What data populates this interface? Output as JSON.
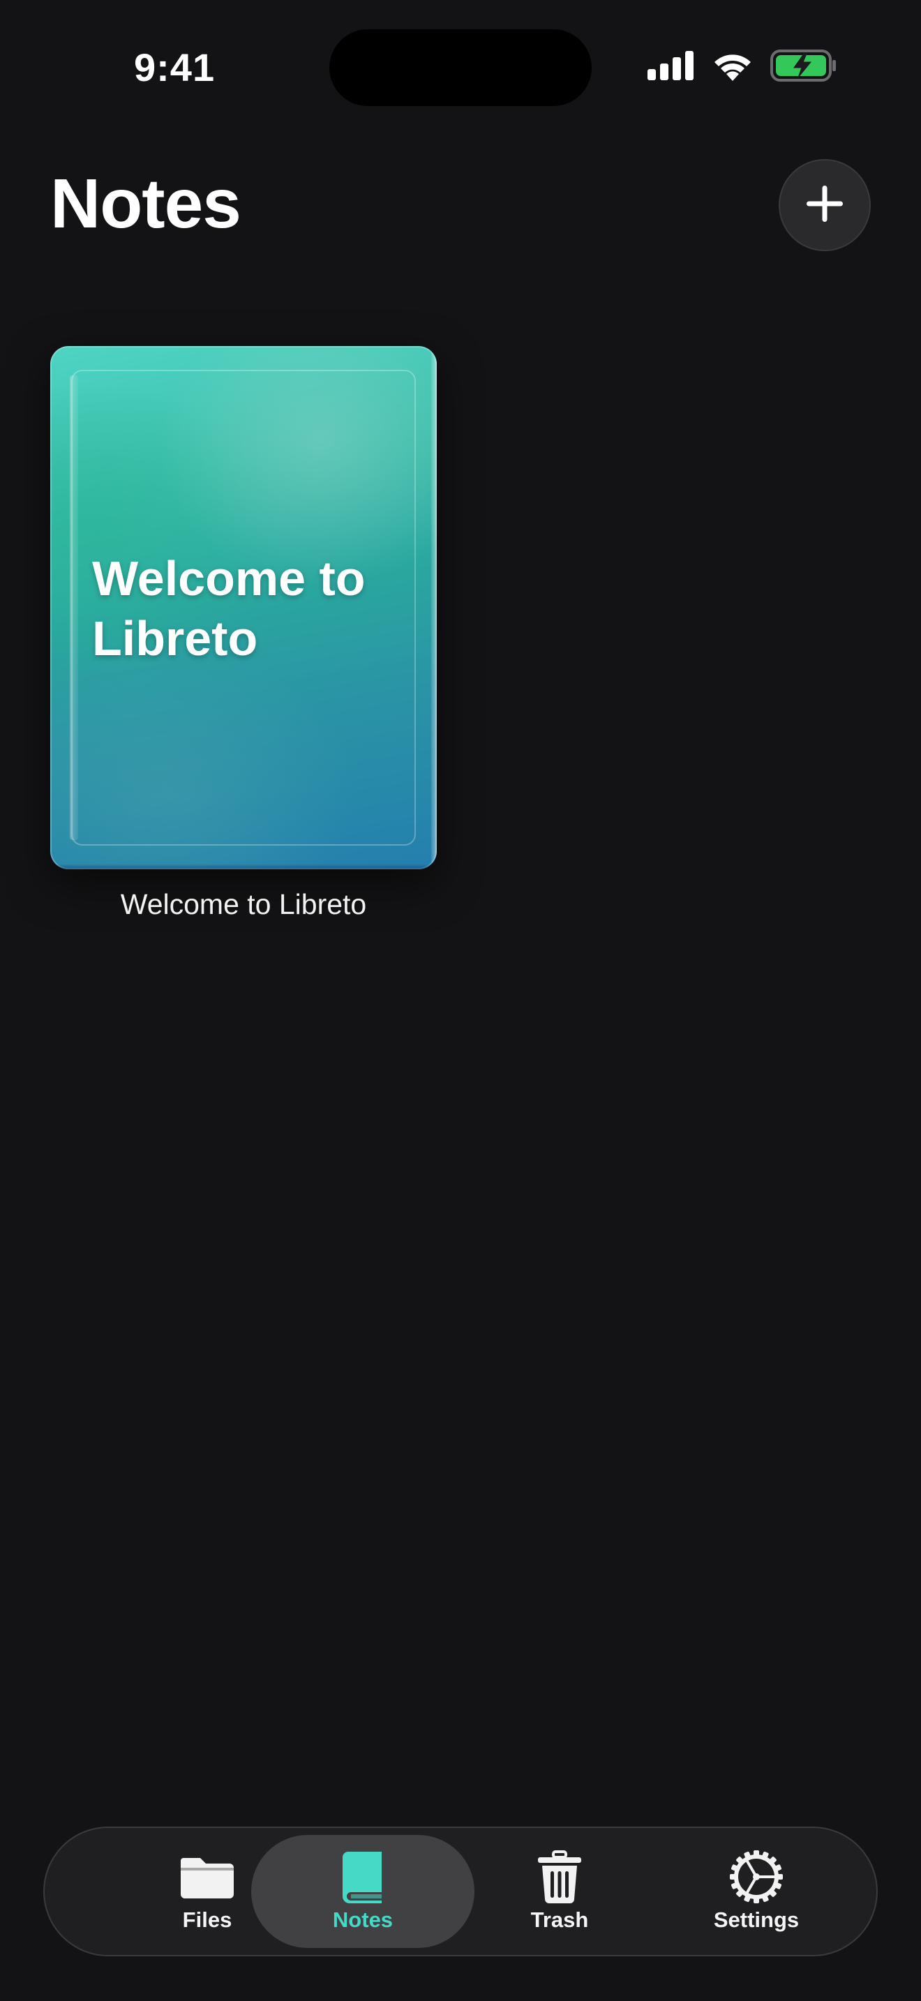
{
  "status_bar": {
    "time": "9:41"
  },
  "header": {
    "title": "Notes",
    "add_icon": "plus-icon"
  },
  "notebooks": [
    {
      "cover_title": "Welcome to Libreto",
      "caption": "Welcome to Libreto",
      "cover_colors": [
        "#4fd3c3",
        "#2aa79f",
        "#247fae"
      ]
    }
  ],
  "tab_bar": {
    "tabs": [
      {
        "label": "Files",
        "icon": "folder-icon",
        "selected": false
      },
      {
        "label": "Notes",
        "icon": "book-icon",
        "selected": true
      },
      {
        "label": "Trash",
        "icon": "trash-icon",
        "selected": false
      },
      {
        "label": "Settings",
        "icon": "gear-icon",
        "selected": false
      }
    ]
  },
  "colors": {
    "background": "#131315",
    "accent": "#45d9c6",
    "battery": "#34c759"
  }
}
